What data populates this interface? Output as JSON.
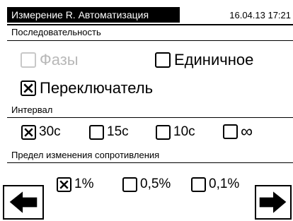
{
  "header": {
    "title": "Измерение R. Автоматизация",
    "datetime": "16.04.13 17:21"
  },
  "sequence": {
    "label": "Последовательность",
    "phases": {
      "label": "Фазы",
      "checked": false,
      "disabled": true
    },
    "single": {
      "label": "Единичное",
      "checked": false
    },
    "switch": {
      "label": "Переключатель",
      "checked": true
    }
  },
  "interval": {
    "label": "Интервал",
    "options": [
      {
        "label": "30с",
        "checked": true
      },
      {
        "label": "15с",
        "checked": false
      },
      {
        "label": "10с",
        "checked": false
      },
      {
        "label": "∞",
        "checked": false
      }
    ]
  },
  "resistance_limit": {
    "label": "Предел изменения сопротивления",
    "options": [
      {
        "label": "1%",
        "checked": true
      },
      {
        "label": "0,5%",
        "checked": false
      },
      {
        "label": "0,1%",
        "checked": false
      }
    ]
  },
  "nav": {
    "back_icon": "arrow-left-icon",
    "forward_icon": "arrow-right-icon"
  }
}
